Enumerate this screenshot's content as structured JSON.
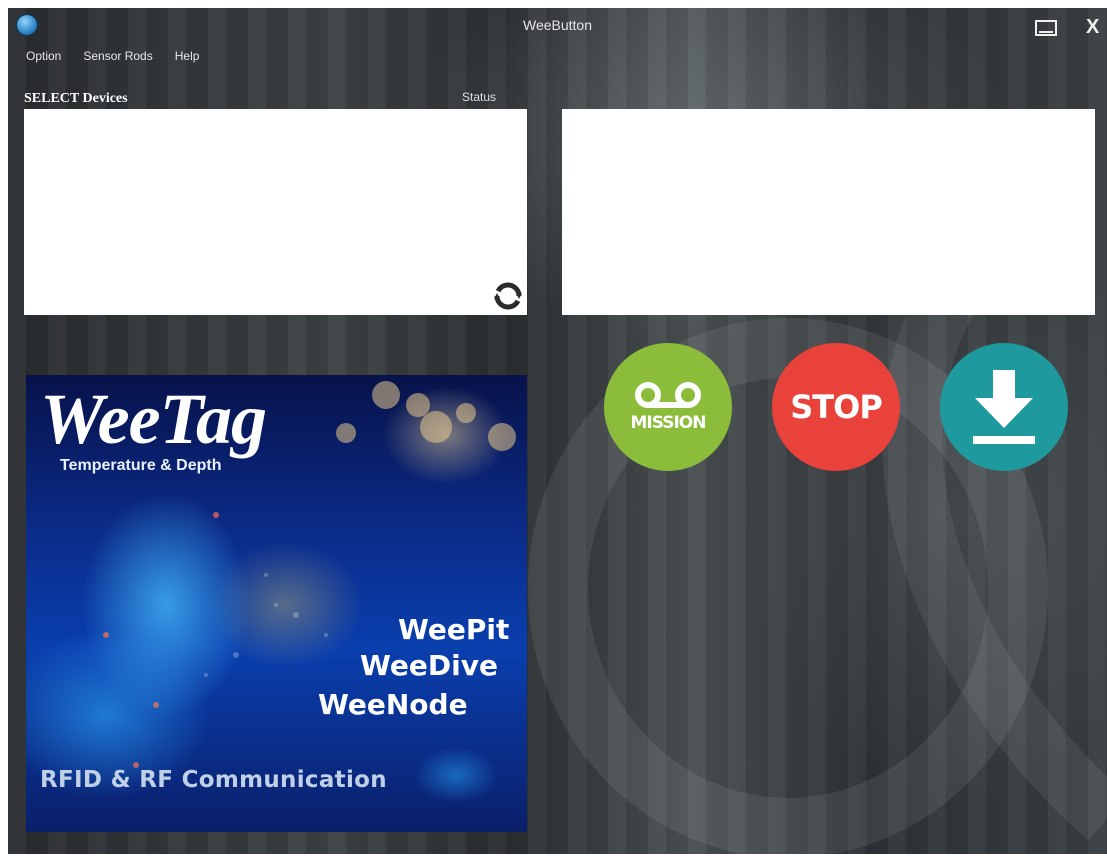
{
  "window": {
    "title": "WeeButton",
    "close_label": "X"
  },
  "menu": {
    "items": [
      "Option",
      "Sensor Rods",
      "Help"
    ]
  },
  "devices": {
    "label": "SELECT Devices",
    "status_label": "Status"
  },
  "actions": {
    "mission_label": "MISSION",
    "stop_label": "STOP"
  },
  "banner": {
    "logo": "WeeTag",
    "subtitle": "Temperature & Depth",
    "products": [
      "WeePit",
      "WeeDive",
      "WeeNode"
    ],
    "footer": "RFID & RF Communication"
  },
  "colors": {
    "mission": "#8bbd3a",
    "stop": "#e8423b",
    "download": "#1e9a9e"
  },
  "icons": {
    "refresh": "refresh-icon",
    "download": "download-icon",
    "mission": "voicemail-icon"
  }
}
